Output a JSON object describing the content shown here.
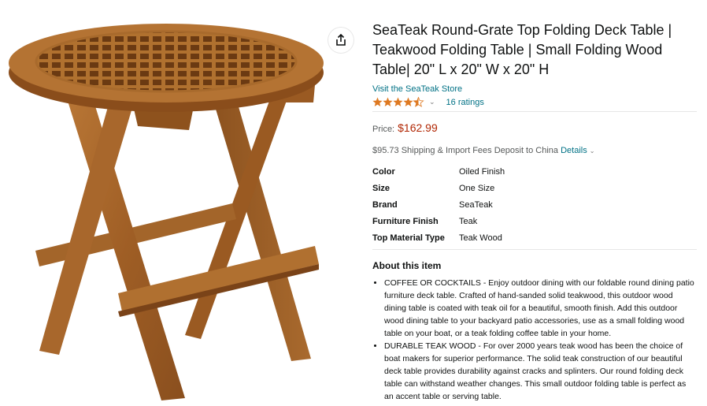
{
  "product": {
    "title": "SeaTeak Round-Grate Top Folding Deck Table | Teakwood Folding Table | Small Folding Wood Table| 20\" L x 20\" W x 20\" H",
    "store_link": "Visit the SeaTeak Store",
    "rating": 4.5,
    "ratings_count": "16 ratings"
  },
  "price": {
    "label": "Price:",
    "value": "$162.99"
  },
  "shipping": {
    "text": "$95.73 Shipping & Import Fees Deposit to China",
    "details_link": "Details"
  },
  "specs": [
    {
      "key": "Color",
      "value": "Oiled Finish"
    },
    {
      "key": "Size",
      "value": "One Size"
    },
    {
      "key": "Brand",
      "value": "SeaTeak"
    },
    {
      "key": "Furniture Finish",
      "value": "Teak"
    },
    {
      "key": "Top Material Type",
      "value": "Teak Wood"
    }
  ],
  "about": {
    "heading": "About this item",
    "bullets": [
      "COFFEE OR COCKTAILS - Enjoy outdoor dining with our foldable round dining patio furniture deck table. Crafted of hand-sanded solid teakwood, this outdoor wood dining table is coated with teak oil for a beautiful, smooth finish. Add this outdoor wood dining table to your backyard patio accessories, use as a small folding wood table on your boat, or a teak folding coffee table in your home.",
      "DURABLE TEAK WOOD - For over 2000 years teak wood has been the choice of boat makers for superior performance. The solid teak construction of our beautiful deck table provides durability against cracks and splinters. Our round folding deck table can withstand weather changes. This small outdoor folding table is perfect as an accent table or serving table."
    ]
  },
  "colors": {
    "link": "#007185",
    "price": "#b12704",
    "star": "#de7921",
    "teak": "#a8672c"
  },
  "icons": {
    "share": "share-icon",
    "star": "star-icon"
  }
}
